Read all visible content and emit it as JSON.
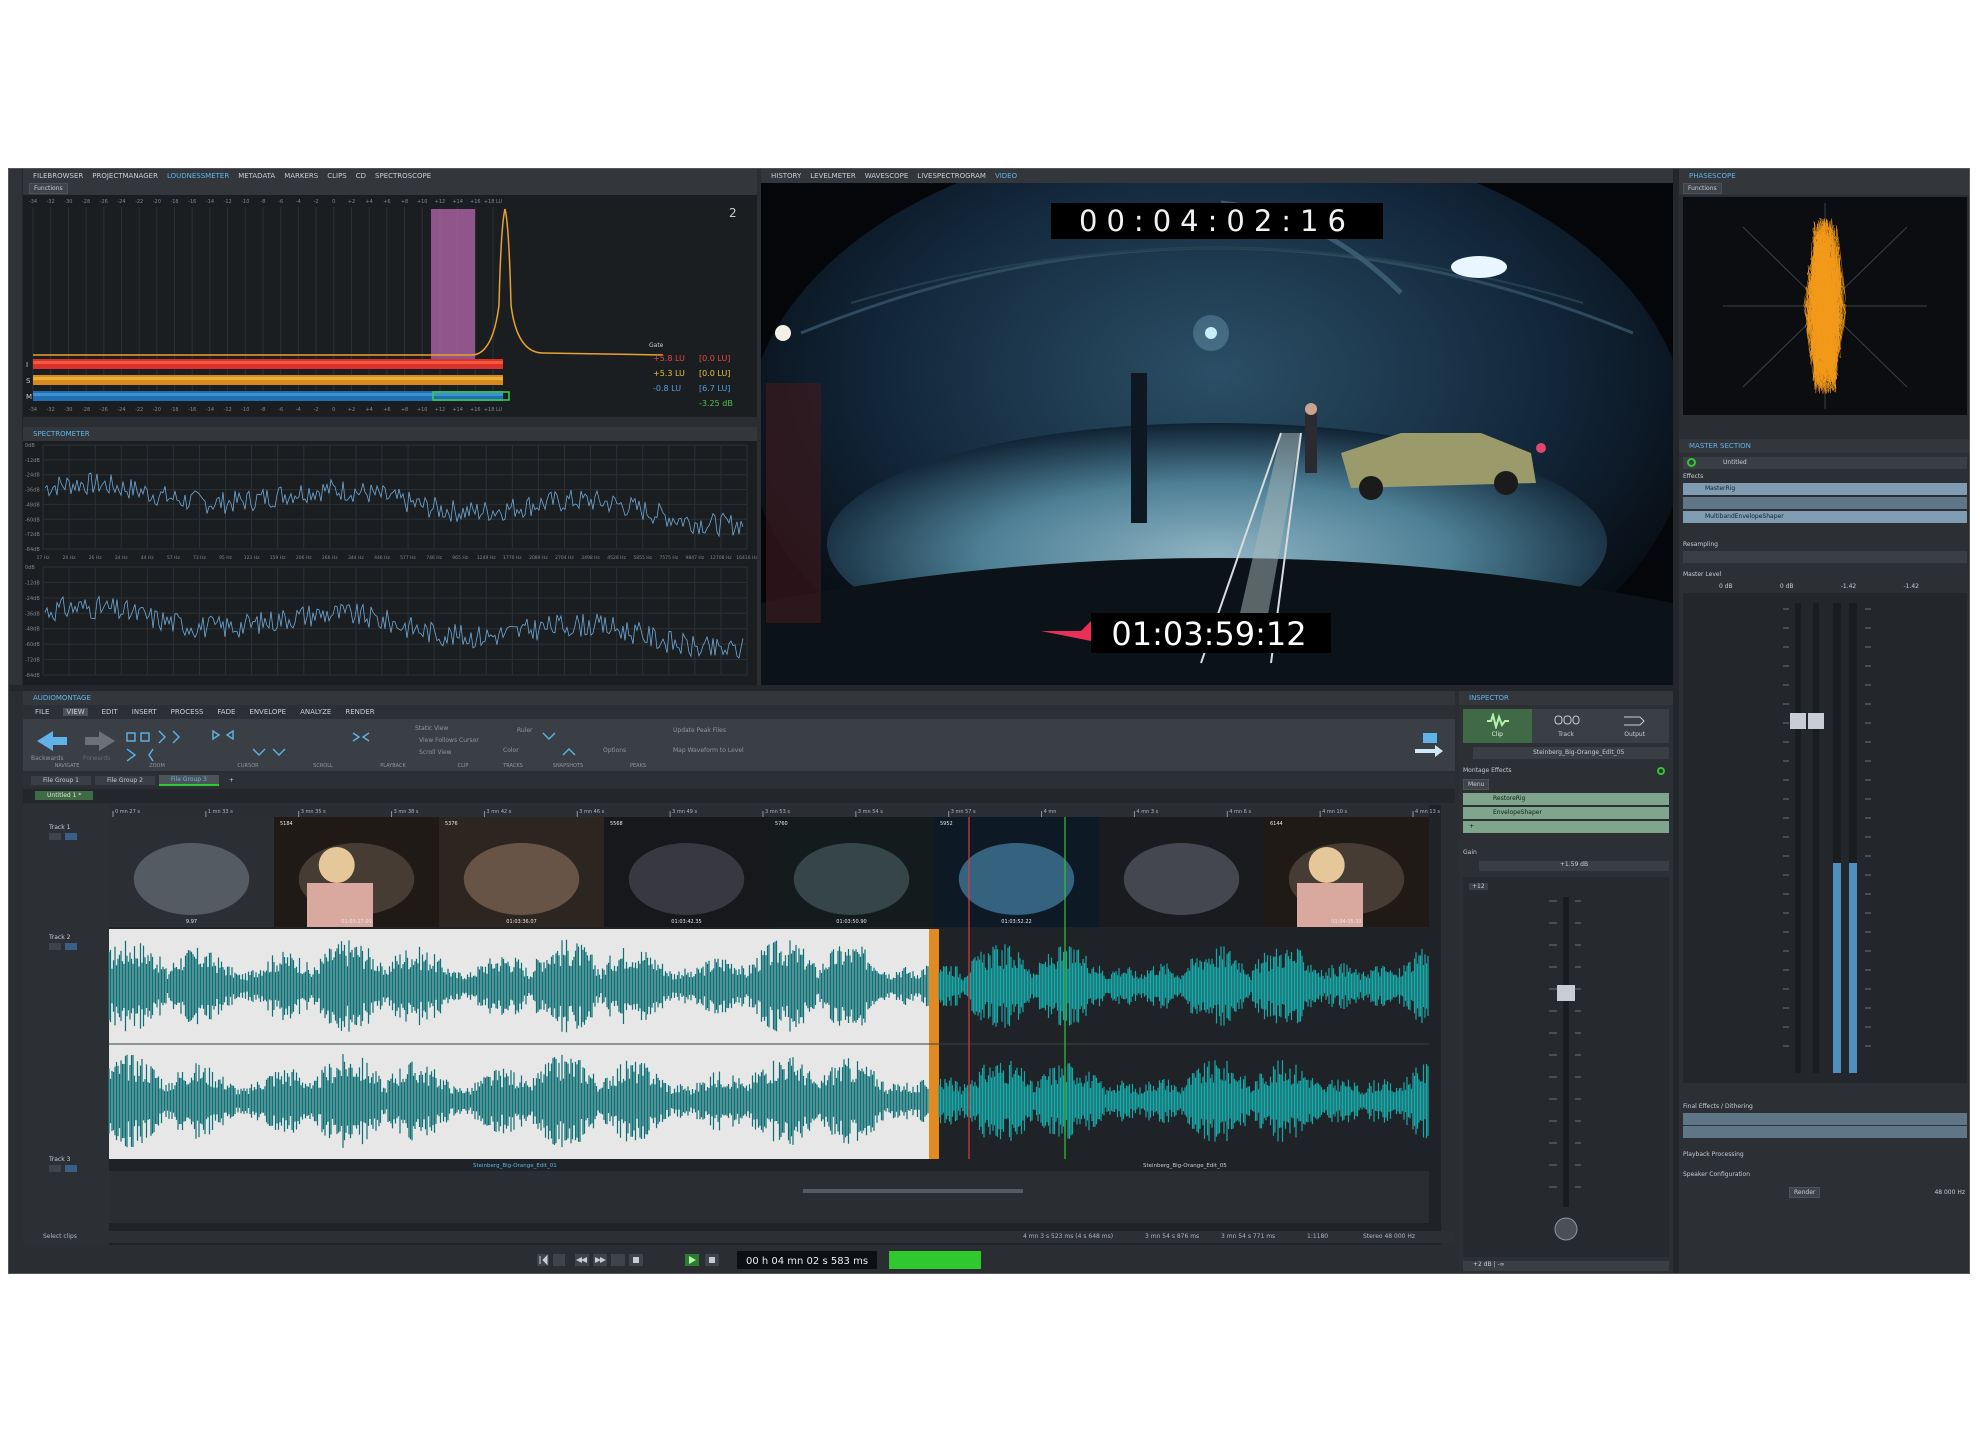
{
  "top_left": {
    "tabs": [
      "FILEBROWSER",
      "PROJECTMANAGER",
      "LOUDNESSMETER",
      "METADATA",
      "MARKERS",
      "CLIPS",
      "CD",
      "SPECTROSCOPE"
    ],
    "functions_label": "Functions",
    "meter_scale": [
      "-34",
      "-32",
      "-30",
      "-28",
      "-26",
      "-24",
      "-22",
      "-20",
      "-18",
      "-16",
      "-14",
      "-12",
      "-10",
      "-8",
      "-6",
      "-4",
      "-2",
      "0",
      "+2",
      "+4",
      "+6",
      "+8",
      "+10",
      "+12",
      "+14",
      "+16",
      "+18 LU"
    ],
    "bar_letters": [
      "I",
      "S",
      "M"
    ],
    "gate_label": "Gate",
    "readouts": [
      {
        "lu": "+5.8 LU",
        "bracket": "[0.0 LU]",
        "color": "#e04a3f"
      },
      {
        "lu": "+5.3 LU",
        "bracket": "[0.0 LU]",
        "color": "#e0c23f"
      },
      {
        "lu": "-0.8 LU",
        "bracket": "[6.7 LU]",
        "color": "#4fa0e0"
      },
      {
        "lu": "",
        "bracket": "-3.25 dB",
        "color": "#4fc04f"
      }
    ]
  },
  "spectrometer": {
    "title": "SPECTROMETER",
    "freq_labels": [
      "17 Hz",
      "20 Hz",
      "26 Hz",
      "34 Hz",
      "44 Hz",
      "57 Hz",
      "73 Hz",
      "95 Hz",
      "123 Hz",
      "159 Hz",
      "206 Hz",
      "266 Hz",
      "344 Hz",
      "446 Hz",
      "577 Hz",
      "746 Hz",
      "965 Hz",
      "1249 Hz",
      "1770 Hz",
      "2089 Hz",
      "2704 Hz",
      "3498 Hz",
      "4528 Hz",
      "5855 Hz",
      "7575 Hz",
      "9847 Hz",
      "12708 Hz",
      "16416 Hz"
    ],
    "db_labels": [
      "0dB",
      "-12dB",
      "-24dB",
      "-36dB",
      "-48dB",
      "-60dB",
      "-72dB",
      "-84dB"
    ]
  },
  "video": {
    "tabs": [
      "HISTORY",
      "LEVELMETER",
      "WAVESCOPE",
      "LIVESPECTROGRAM",
      "VIDEO"
    ],
    "timecode_top": "00:04:02:16",
    "timecode_bottom": "01:03:59:12"
  },
  "phasescope": {
    "title": "PHASESCOPE",
    "functions_label": "Functions"
  },
  "master": {
    "title": "MASTER SECTION",
    "preset": "Untitled",
    "effects_label": "Effects",
    "effects": [
      "MasterRig",
      "",
      "MultibandEnvelopeShaper"
    ],
    "resampling_label": "Resampling",
    "level_label": "Master Level",
    "level_values": [
      "0 dB",
      "0 dB",
      "-1.42",
      "-1.42"
    ],
    "final_label": "Final Effects / Dithering",
    "playback_label": "Playback Processing",
    "speaker_label": "Speaker Configuration",
    "render_label": "Render",
    "sample_rate": "48 000 Hz"
  },
  "montage": {
    "title": "AUDIOMONTAGE",
    "menu": [
      "FILE",
      "VIEW",
      "EDIT",
      "INSERT",
      "PROCESS",
      "FADE",
      "ENVELOPE",
      "ANALYZE",
      "RENDER"
    ],
    "ribbon_groups": [
      "NAVIGATE",
      "ZOOM",
      "CURSOR",
      "SCROLL",
      "PLAYBACK",
      "CLIP",
      "TRACKS",
      "SNAPSHOTS",
      "PEAKS"
    ],
    "nav_back": "Backwards",
    "nav_fwd": "Forwards",
    "playback_items": [
      "Static View",
      "View Follows Cursor",
      "Scroll View"
    ],
    "ruler_label": "Ruler",
    "color_label": "Color",
    "options_label": "Options",
    "peaks_items": [
      "Update Peak Files",
      "Map Waveform to Level"
    ],
    "file_groups": [
      "File Group 1",
      "File Group 2",
      "File Group 3"
    ],
    "doc_tab": "Untitled 1 *",
    "timeline_ticks": [
      "0 mn 27 s",
      "1 mn 33 s",
      "3 mn 35 s",
      "3 mn 38 s",
      "3 mn 42 s",
      "3 mn 46 s",
      "3 mn 49 s",
      "3 mn 53 s",
      "3 mn 54 s",
      "3 mn 57 s",
      "4 mn",
      "4 mn 3 s",
      "4 mn 6 s",
      "4 mn 10 s",
      "4 mn 13 s"
    ],
    "tracks": [
      "Track 1",
      "Track 2",
      "Track 3"
    ],
    "frame_numbers": [
      "",
      "5184",
      "5376",
      "5568",
      "5760",
      "5952",
      "",
      "6144"
    ],
    "frame_timecodes": [
      "9.97",
      "01:03:27.09",
      "01:03:36.07",
      "01:03:42.35",
      "01:03:50.90",
      "01:03:52.22",
      "",
      "01:04:05.33"
    ],
    "clip_names": [
      "Steinberg_Big-Orange_Edit_01",
      "Steinberg_Big-Orange_Edit_05"
    ],
    "status_left": "Select clips",
    "status_right": "4 mn 3 s 523 ms (4 s 648 ms)",
    "status_right2": "3 mn 54 s 876 ms",
    "status_right3": "3 mn 54 s 771 ms",
    "status_right4": "1:1180",
    "status_right5": "Stereo 48 000 Hz",
    "transport_time": "00 h 04 mn 02 s 583 ms"
  },
  "inspector": {
    "title": "INSPECTOR",
    "tabs": [
      "Clip",
      "Track",
      "Output"
    ],
    "clip_name": "Steinberg_Big-Orange_Edit_05",
    "effects_label": "Montage Effects",
    "menu_label": "Menu",
    "effects": [
      "RestoreRig",
      "EnvelopeShaper"
    ],
    "gain_label": "Gain",
    "gain_value": "+1.59 dB",
    "fader_value": "+12",
    "bottom_value": "+2 dB | -∞"
  },
  "colors": {
    "waveform": "#1aa7a8",
    "waveform_dark": "#0e6f74",
    "selection_bg": "#e7e7e7",
    "orange": "#e08a21",
    "accent_blue": "#5fb3e8",
    "phase_orange": "#f39a1b",
    "level_green": "#2fc82f"
  }
}
